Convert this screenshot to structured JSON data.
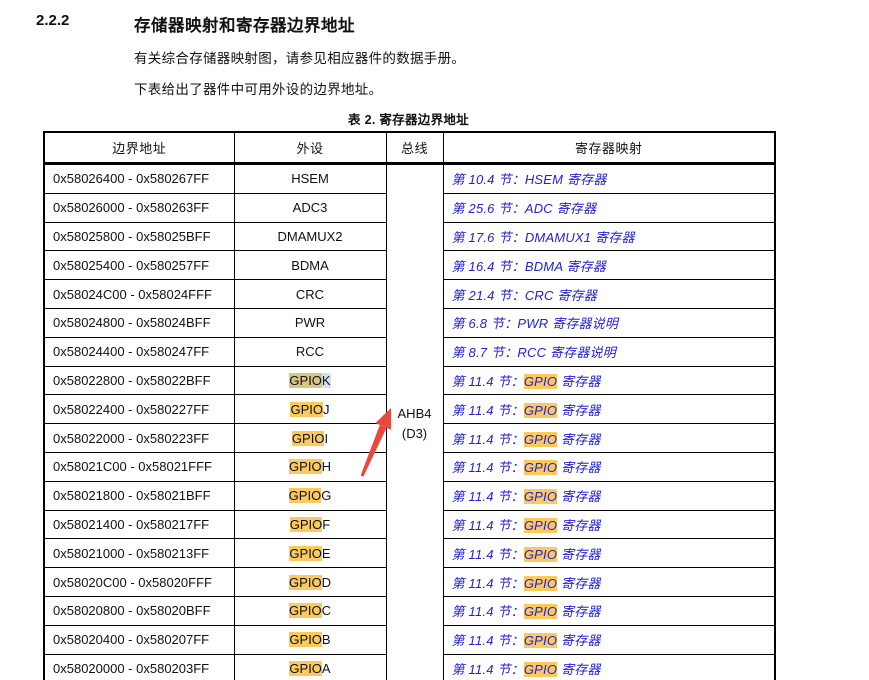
{
  "section": {
    "number": "2.2.2",
    "title": "存储器映射和寄存器边界地址"
  },
  "paragraphs": {
    "p1": "有关综合存储器映射图，请参见相应器件的数据手册。",
    "p2": "下表给出了器件中可用外设的边界地址。"
  },
  "table": {
    "caption": "表 2. 寄存器边界地址",
    "headers": {
      "address": "边界地址",
      "peripheral": "外设",
      "bus": "总线",
      "register_map": "寄存器映射"
    },
    "bus": {
      "line1": "AHB4",
      "line2": "(D3)"
    },
    "rows": [
      {
        "address": "0x58026400 - 0x580267FF",
        "periph_hl": "",
        "periph_rest": "HSEM",
        "hl_variant": "none",
        "link_pre": "第 10.4 节：HSEM 寄存器",
        "link_hl": "",
        "link_post": ""
      },
      {
        "address": "0x58026000 - 0x580263FF",
        "periph_hl": "",
        "periph_rest": "ADC3",
        "hl_variant": "none",
        "link_pre": "第 25.6 节：ADC 寄存器",
        "link_hl": "",
        "link_post": ""
      },
      {
        "address": "0x58025800 - 0x58025BFF",
        "periph_hl": "",
        "periph_rest": "DMAMUX2",
        "hl_variant": "none",
        "link_pre": "第 17.6 节：DMAMUX1 寄存器",
        "link_hl": "",
        "link_post": ""
      },
      {
        "address": "0x58025400 - 0x580257FF",
        "periph_hl": "",
        "periph_rest": "BDMA",
        "hl_variant": "none",
        "link_pre": "第 16.4 节：BDMA 寄存器",
        "link_hl": "",
        "link_post": ""
      },
      {
        "address": "0x58024C00 - 0x58024FFF",
        "periph_hl": "",
        "periph_rest": "CRC",
        "hl_variant": "none",
        "link_pre": "第 21.4 节：CRC 寄存器",
        "link_hl": "",
        "link_post": ""
      },
      {
        "address": "0x58024800 - 0x58024BFF",
        "periph_hl": "",
        "periph_rest": "PWR",
        "hl_variant": "none",
        "link_pre": "第 6.8 节：PWR 寄存器说明",
        "link_hl": "",
        "link_post": ""
      },
      {
        "address": "0x58024400 - 0x580247FF",
        "periph_hl": "",
        "periph_rest": "RCC",
        "hl_variant": "none",
        "link_pre": "第 8.7 节：RCC 寄存器说明",
        "link_hl": "",
        "link_post": ""
      },
      {
        "address": "0x58022800 - 0x58022BFF",
        "periph_hl": "GPIO",
        "periph_rest": "K",
        "hl_variant": "selected",
        "link_pre": "第 11.4 节：",
        "link_hl": "GPIO",
        "link_post": " 寄存器"
      },
      {
        "address": "0x58022400 - 0x580227FF",
        "periph_hl": "GPIO",
        "periph_rest": "J",
        "hl_variant": "orange",
        "link_pre": "第 11.4 节：",
        "link_hl": "GPIO",
        "link_post": " 寄存器"
      },
      {
        "address": "0x58022000 - 0x580223FF",
        "periph_hl": "GPIO",
        "periph_rest": "I",
        "hl_variant": "orange",
        "link_pre": "第 11.4 节：",
        "link_hl": "GPIO",
        "link_post": " 寄存器"
      },
      {
        "address": "0x58021C00 - 0x58021FFF",
        "periph_hl": "GPIO",
        "periph_rest": "H",
        "hl_variant": "orange",
        "link_pre": "第 11.4 节：",
        "link_hl": "GPIO",
        "link_post": " 寄存器"
      },
      {
        "address": "0x58021800 - 0x58021BFF",
        "periph_hl": "GPIO",
        "periph_rest": "G",
        "hl_variant": "orange",
        "link_pre": "第 11.4 节：",
        "link_hl": "GPIO",
        "link_post": " 寄存器"
      },
      {
        "address": "0x58021400 - 0x580217FF",
        "periph_hl": "GPIO",
        "periph_rest": "F",
        "hl_variant": "orange",
        "link_pre": "第 11.4 节：",
        "link_hl": "GPIO",
        "link_post": " 寄存器"
      },
      {
        "address": "0x58021000 - 0x580213FF",
        "periph_hl": "GPIO",
        "periph_rest": "E",
        "hl_variant": "orange",
        "link_pre": "第 11.4 节：",
        "link_hl": "GPIO",
        "link_post": " 寄存器"
      },
      {
        "address": "0x58020C00 - 0x58020FFF",
        "periph_hl": "GPIO",
        "periph_rest": "D",
        "hl_variant": "orange",
        "link_pre": "第 11.4 节：",
        "link_hl": "GPIO",
        "link_post": " 寄存器"
      },
      {
        "address": "0x58020800 - 0x58020BFF",
        "periph_hl": "GPIO",
        "periph_rest": "C",
        "hl_variant": "orange",
        "link_pre": "第 11.4 节：",
        "link_hl": "GPIO",
        "link_post": " 寄存器"
      },
      {
        "address": "0x58020400 - 0x580207FF",
        "periph_hl": "GPIO",
        "periph_rest": "B",
        "hl_variant": "orange",
        "link_pre": "第 11.4 节：",
        "link_hl": "GPIO",
        "link_post": " 寄存器"
      },
      {
        "address": "0x58020000 - 0x580203FF",
        "periph_hl": "GPIO",
        "periph_rest": "A",
        "hl_variant": "orange",
        "link_pre": "第 11.4 节：",
        "link_hl": "GPIO",
        "link_post": " 寄存器"
      }
    ]
  },
  "colors": {
    "search_highlight": "#fcc95e",
    "selected_highlight": "#d9c584",
    "selection_blue": "#d4e1ef",
    "link_blue": "#2322d3",
    "arrow_red": "#e8493c"
  }
}
